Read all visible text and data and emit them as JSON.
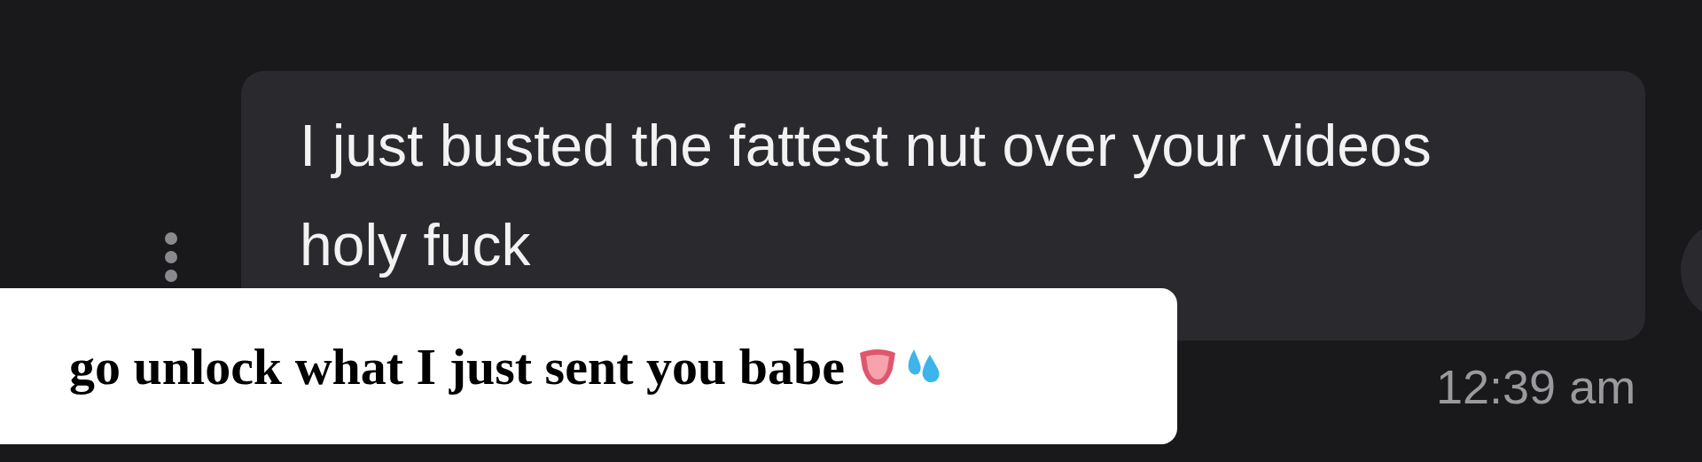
{
  "message": {
    "text": "I just busted the fattest nut over your videos holy fuck",
    "time": "12:39 am"
  },
  "caption": {
    "text": "go unlock what I just sent you babe"
  }
}
